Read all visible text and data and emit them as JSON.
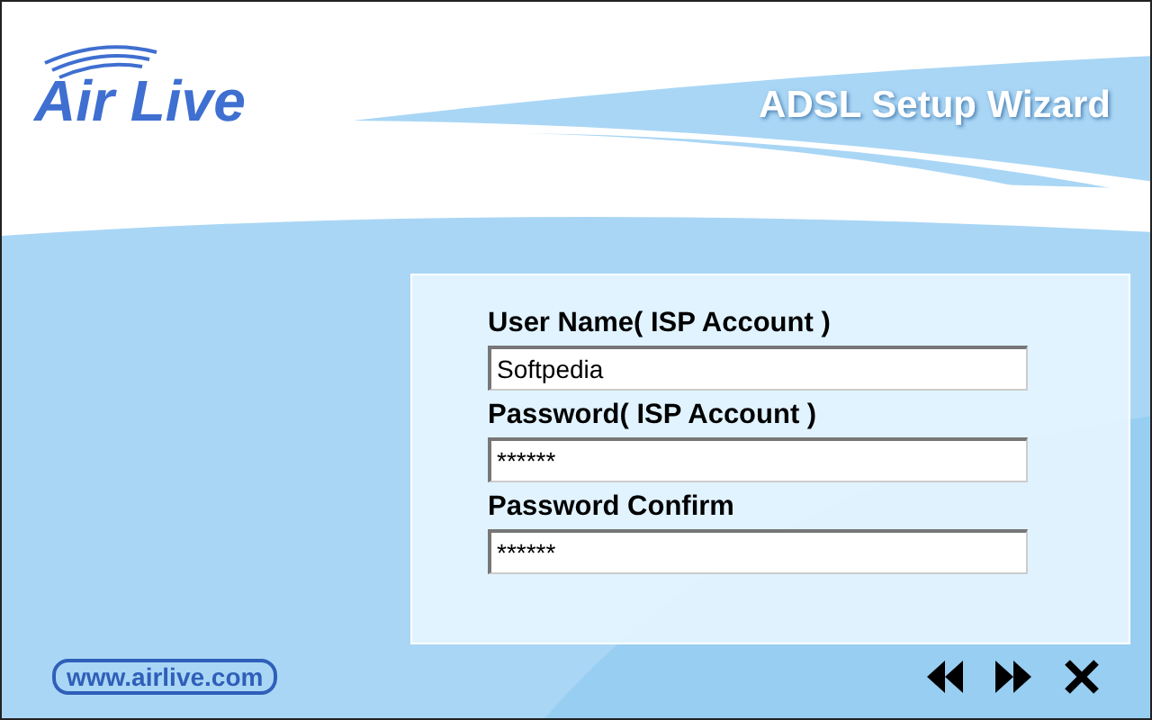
{
  "header": {
    "logo": "Air Live",
    "title": "ADSL Setup Wizard"
  },
  "form": {
    "fields": [
      {
        "label": "User Name( ISP Account )",
        "value": "Softpedia"
      },
      {
        "label": "Password( ISP Account )",
        "value": "******"
      },
      {
        "label": "Password Confirm",
        "value": "******"
      }
    ]
  },
  "footer": {
    "website": "www.airlive.com"
  }
}
